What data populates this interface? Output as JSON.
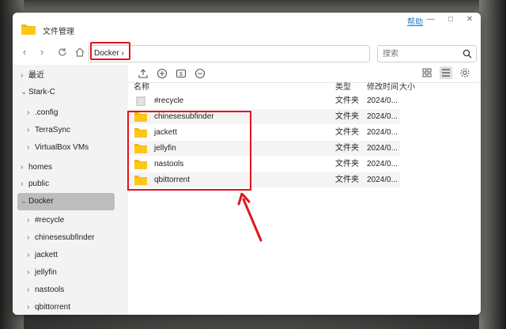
{
  "window": {
    "title": "文件管理",
    "help_label": "帮助",
    "minimize_symbol": "▭",
    "maximize_symbol": "□",
    "close_symbol": "✕"
  },
  "toolbar": {
    "path_crumb": "Docker",
    "search_placeholder": "搜索"
  },
  "sidebar": {
    "items": [
      {
        "label": "最近",
        "chevron": "›"
      },
      {
        "label": "Stark-C",
        "chevron": "⌄"
      },
      {
        "label": ".config",
        "chevron": "›"
      },
      {
        "label": "TerraSync",
        "chevron": "›"
      },
      {
        "label": "VirtualBox VMs",
        "chevron": "›"
      },
      {
        "label": "homes",
        "chevron": "›"
      },
      {
        "label": "public",
        "chevron": "›"
      },
      {
        "label": "Docker",
        "chevron": "⌄"
      },
      {
        "label": "#recycle",
        "chevron": "›"
      },
      {
        "label": "chinesesubfinder",
        "chevron": "›"
      },
      {
        "label": "jackett",
        "chevron": "›"
      },
      {
        "label": "jellyfin",
        "chevron": "›"
      },
      {
        "label": "nastools",
        "chevron": "›"
      },
      {
        "label": "qbittorrent",
        "chevron": "›"
      }
    ]
  },
  "list": {
    "headers": {
      "name": "名称",
      "type": "类型",
      "modified": "修改时间",
      "size": "大小"
    },
    "rows": [
      {
        "name": "#recycle",
        "type": "文件夹",
        "date": "2024/0...",
        "icon": "trash-icon"
      },
      {
        "name": "chinesesubfinder",
        "type": "文件夹",
        "date": "2024/0...",
        "icon": "folder-icon"
      },
      {
        "name": "jackett",
        "type": "文件夹",
        "date": "2024/0...",
        "icon": "folder-icon"
      },
      {
        "name": "jellyfin",
        "type": "文件夹",
        "date": "2024/0...",
        "icon": "folder-icon"
      },
      {
        "name": "nastools",
        "type": "文件夹",
        "date": "2024/0...",
        "icon": "folder-icon"
      },
      {
        "name": "qbittorrent",
        "type": "文件夹",
        "date": "2024/0...",
        "icon": "folder-icon"
      }
    ]
  },
  "colors": {
    "folder": "#f5b800",
    "highlight": "#e0141e",
    "accent_link": "#1a7ad4"
  }
}
